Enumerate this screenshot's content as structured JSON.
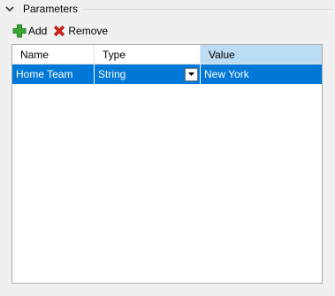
{
  "group": {
    "title": "Parameters"
  },
  "toolbar": {
    "add_label": "Add",
    "remove_label": "Remove"
  },
  "grid": {
    "columns": [
      "Name",
      "Type",
      "Value"
    ],
    "selected_column": "Value",
    "rows": [
      {
        "name": "Home Team",
        "type": "String",
        "value": "New York",
        "selected": true
      }
    ]
  },
  "colors": {
    "selection": "#0078d7",
    "header_selected": "#bcdcf4",
    "add_icon": "#3aaa35",
    "remove_icon": "#e0201b"
  }
}
